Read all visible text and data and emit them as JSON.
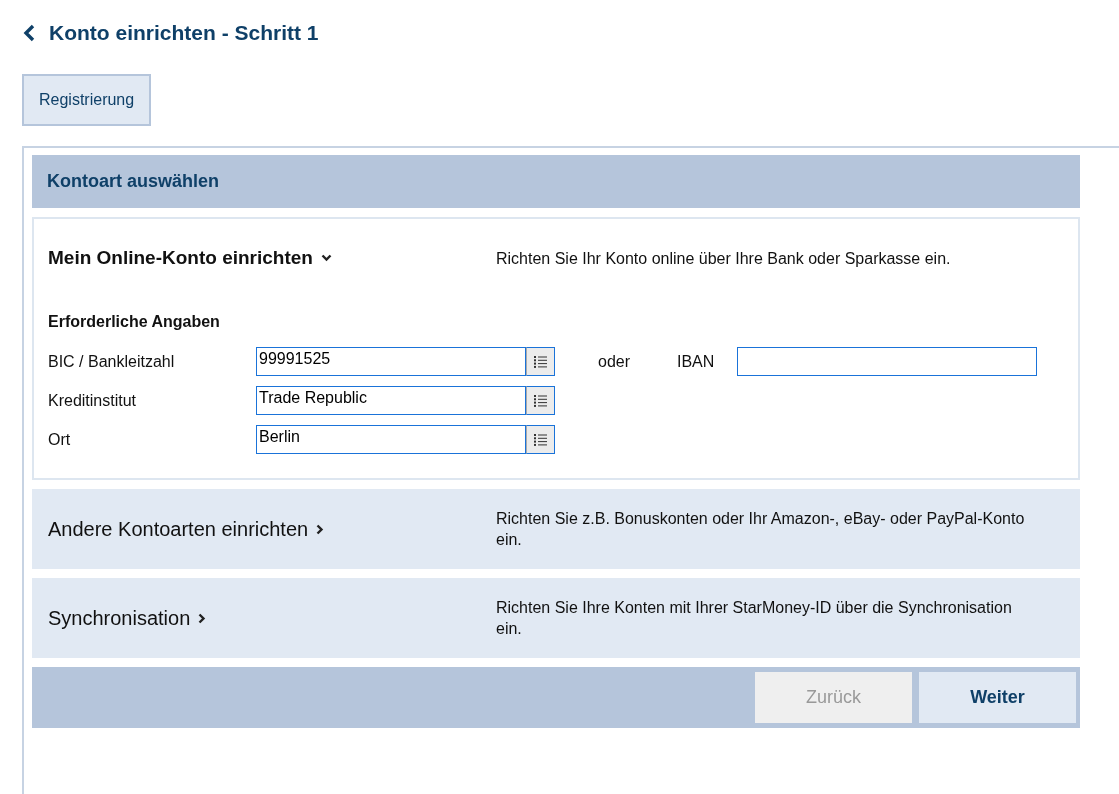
{
  "header": {
    "title": "Konto einrichten - Schritt 1"
  },
  "tabs": [
    {
      "label": "Registrierung",
      "selected": true
    }
  ],
  "panel": {
    "title": "Kontoart auswählen"
  },
  "sections": [
    {
      "title": "Mein Online-Konto einrichten",
      "description": "Richten Sie Ihr Konto online über Ihre Bank oder Sparkasse ein.",
      "expanded": true,
      "form": {
        "heading": "Erforderliche Angaben",
        "fields": [
          {
            "label": "BIC / Bankleitzahl",
            "value": "99991525",
            "lookup": true,
            "alternative": {
              "connector": "oder",
              "label": "IBAN"
            }
          },
          {
            "label": "Kreditinstitut",
            "value": "Trade Republic",
            "lookup": true
          },
          {
            "label": "Ort",
            "value": "Berlin",
            "lookup": true
          }
        ]
      }
    },
    {
      "title": "Andere Kontoarten einrichten",
      "description": "Richten Sie z.B. Bonuskonten oder Ihr Amazon-, eBay- oder PayPal-Konto ein.",
      "expanded": false
    },
    {
      "title": "Synchronisation",
      "description": "Richten Sie Ihre Konten mit Ihrer StarMoney-ID über die Synchronisation ein.",
      "expanded": false
    }
  ],
  "buttons": [
    {
      "label": "Zurück",
      "disabled": true
    },
    {
      "label": "Weiter",
      "disabled": false
    }
  ]
}
